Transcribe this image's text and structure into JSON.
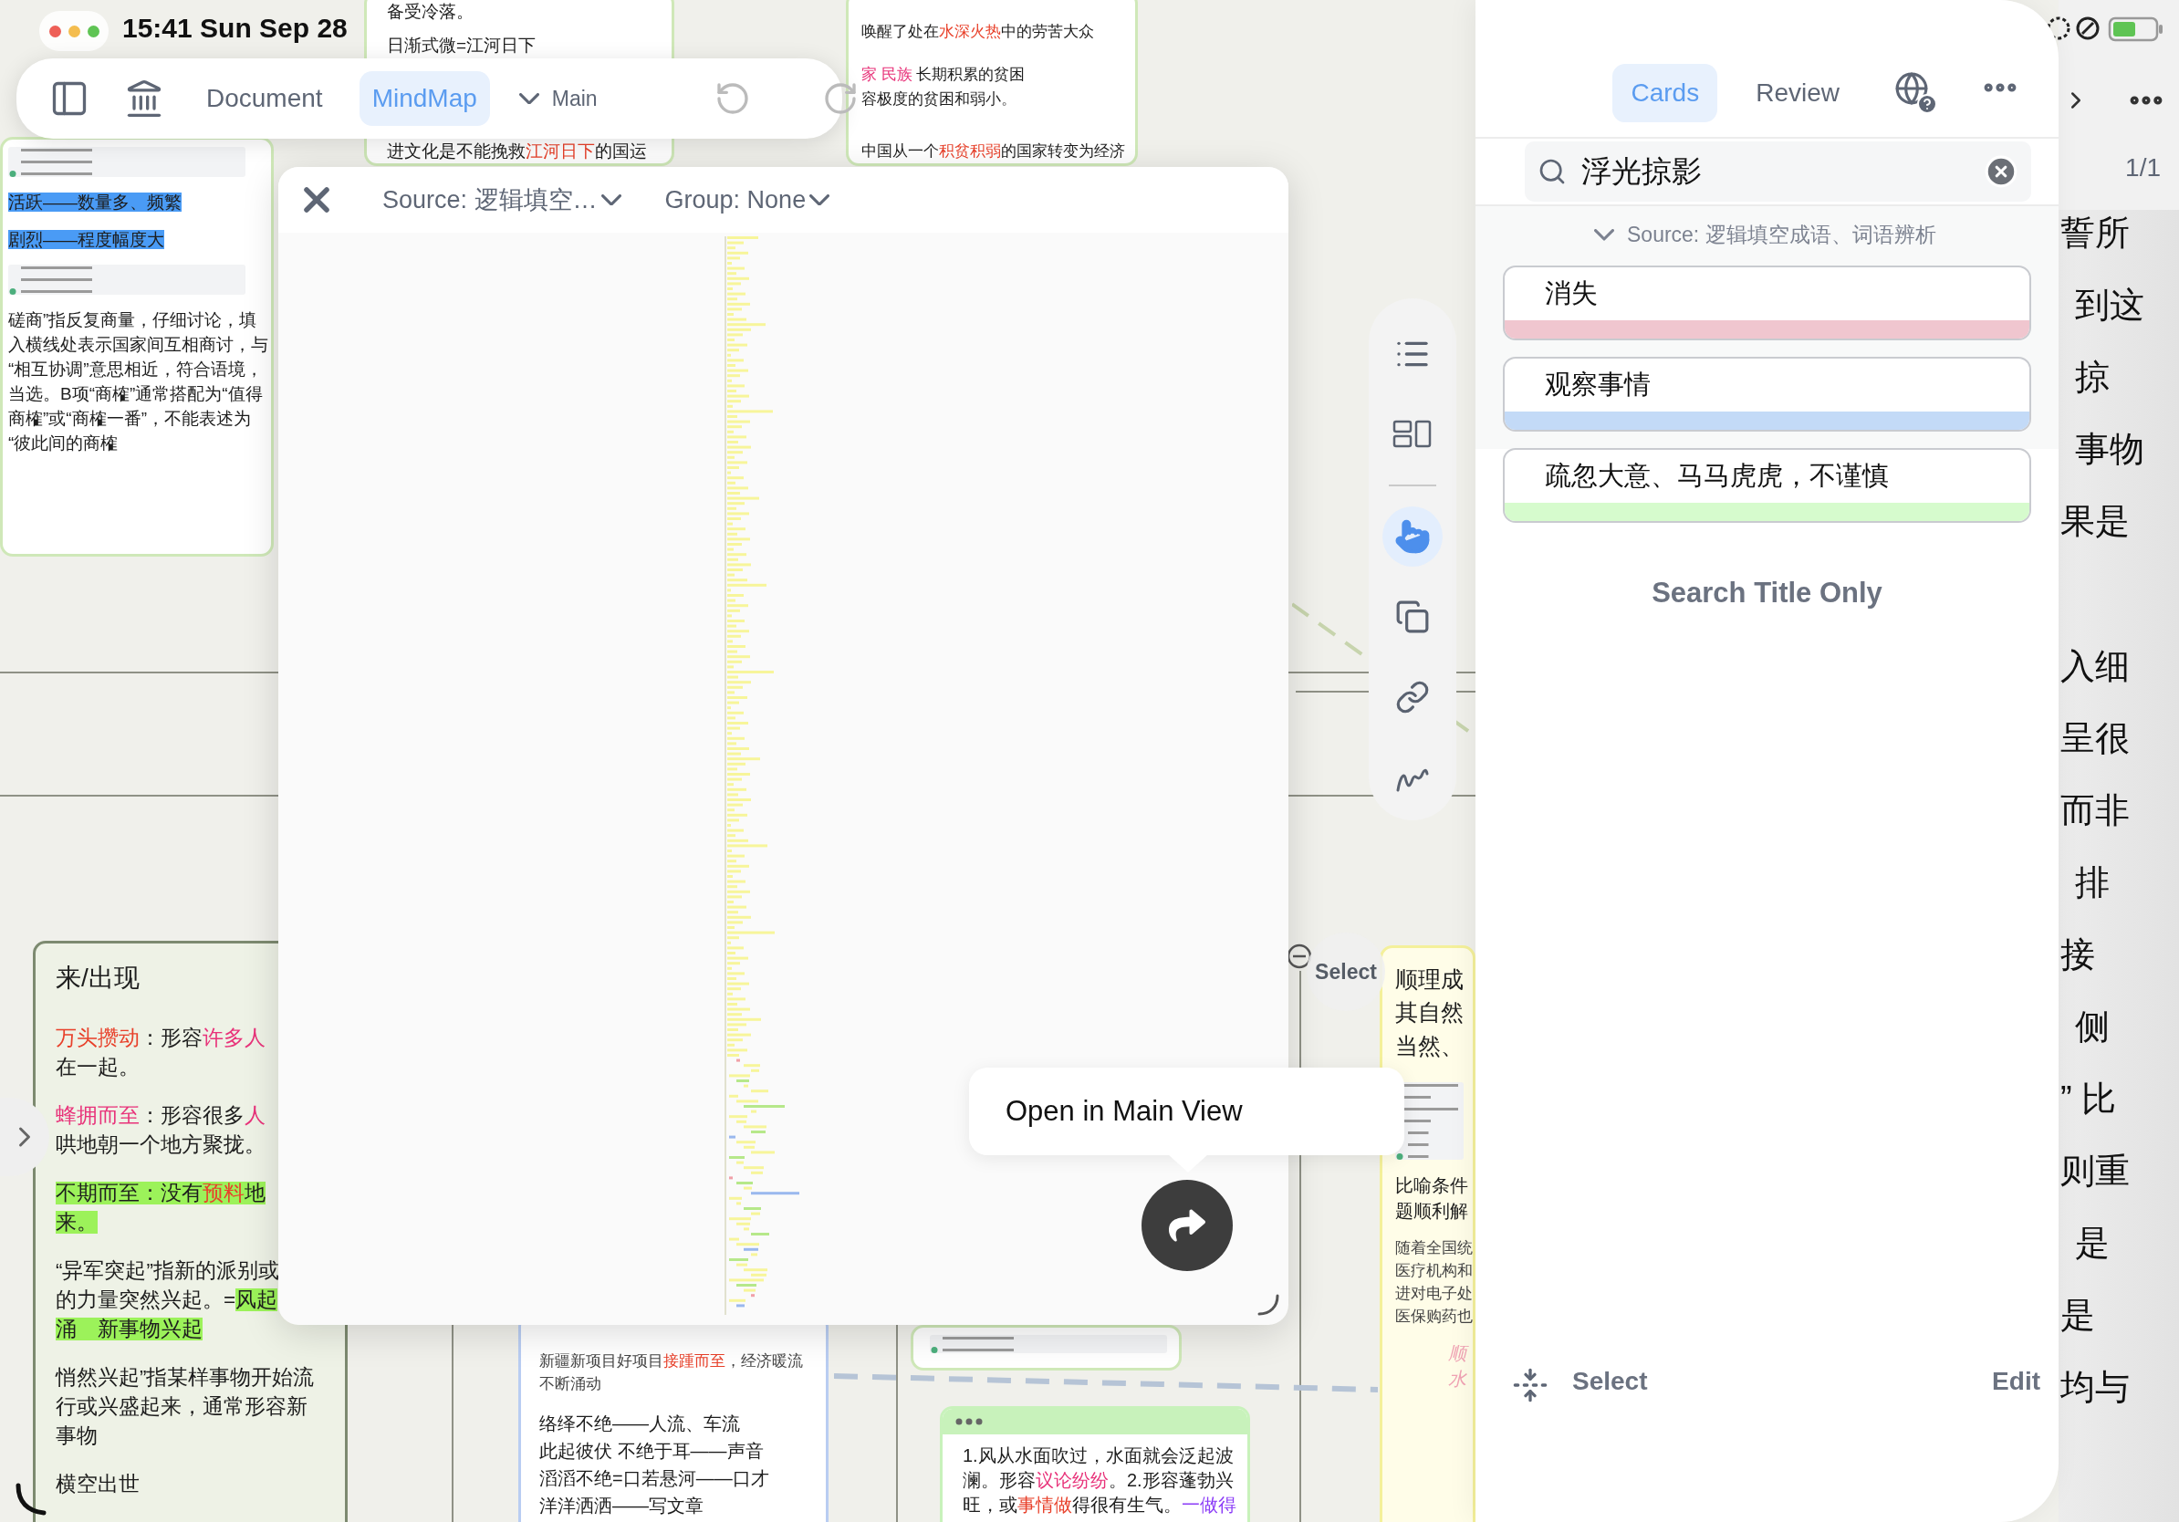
{
  "status_bar": {
    "time": "15:41 Sun Sep 28"
  },
  "toolbar": {
    "tabs": [
      {
        "label": "Document",
        "selected": false
      },
      {
        "label": "MindMap",
        "selected": true
      }
    ],
    "branch": "Main"
  },
  "canvas": {
    "cards": [
      {
        "kind": "note",
        "blocks": [
          {
            "kind": "thumbnail"
          },
          {
            "kind": "text",
            "lines": [
              [
                {
                  "kind": "selected",
                  "text": "活跃——数量多、频繁"
                }
              ]
            ]
          },
          {
            "kind": "text",
            "lines": [
              [
                {
                  "kind": "selected",
                  "text": "剧烈——程度幅度大"
                }
              ]
            ]
          },
          {
            "kind": "thumbnail"
          },
          {
            "kind": "text",
            "lines": [
              "磋商”指反复商量，仔细讨论，填",
              "入横线处表示国家间互相商讨，与",
              "“相互协调”意思相近，符合语境，",
              "当选。B项“商榷”通常搭配为“值得",
              "商榷”或“商榷一番”，不能表述为",
              "“彼此间的商榷"
            ]
          }
        ]
      },
      {
        "kind": "note",
        "blocks": [
          {
            "kind": "text",
            "lines": [
              "备受冷落。"
            ]
          },
          {
            "kind": "text",
            "lines": [
              "日渐式微=江河日下"
            ]
          },
          {
            "kind": "text",
            "lines": [
              [
                {
                  "kind": "plain",
                  "text": "进文化是不能挽救"
                },
                {
                  "kind": "keyword",
                  "text": "江河日下"
                },
                {
                  "kind": "plain",
                  "text": "的国运"
                }
              ]
            ]
          }
        ]
      },
      {
        "kind": "note",
        "blocks": [
          {
            "kind": "text",
            "lines": [
              [
                {
                  "kind": "plain",
                  "text": "唤醒了处在"
                },
                {
                  "kind": "keyword",
                  "text": "水深火热"
                },
                {
                  "kind": "plain",
                  "text": "中的劳苦大众"
                }
              ]
            ]
          },
          {
            "kind": "text",
            "lines": [
              [
                {
                  "kind": "term",
                  "text": "家 民族"
                },
                {
                  "kind": "plain",
                  "text": " 长期积累的贫困"
                }
              ],
              "容极度的贫困和弱小。"
            ]
          },
          {
            "kind": "text",
            "lines": [
              [
                {
                  "kind": "plain",
                  "text": "中国从一个"
                },
                {
                  "kind": "keyword",
                  "text": "积贫积弱"
                },
                {
                  "kind": "plain",
                  "text": "的国家转变为经济"
                }
              ]
            ]
          }
        ]
      },
      {
        "kind": "outlined",
        "blocks": [
          {
            "kind": "title",
            "lines": [
              "来/出现"
            ]
          },
          {
            "kind": "text",
            "lines": [
              [
                {
                  "kind": "keyword",
                  "text": "万头攒动"
                },
                {
                  "kind": "plain",
                  "text": "：形容"
                },
                {
                  "kind": "term",
                  "text": "许多人"
                }
              ],
              "在一起。"
            ]
          },
          {
            "kind": "text",
            "lines": [
              [
                {
                  "kind": "term",
                  "text": "蜂拥而至"
                },
                {
                  "kind": "plain",
                  "text": "：形容很多"
                },
                {
                  "kind": "term",
                  "text": "人"
                }
              ],
              "哄地朝一个地方聚拢。"
            ]
          },
          {
            "kind": "text",
            "lines": [
              [
                {
                  "kind": "marked",
                  "text": "不期而至：没有"
                },
                {
                  "kind": "marked_keyword",
                  "text": "预料"
                },
                {
                  "kind": "marked",
                  "text": "地"
                }
              ],
              [
                {
                  "kind": "marked",
                  "text": "来。"
                }
              ]
            ]
          },
          {
            "kind": "text",
            "lines": [
              "“异军突起”指新的派别或",
              [
                {
                  "kind": "plain",
                  "text": "的力量突然兴起。="
                },
                {
                  "kind": "marked",
                  "text": "风起"
                }
              ],
              [
                {
                  "kind": "marked",
                  "text": "涌　新事物兴起"
                }
              ]
            ]
          },
          {
            "kind": "text",
            "lines": [
              "悄然兴起”指某样事物开始流",
              "行或兴盛起来，通常形容新",
              "事物"
            ]
          },
          {
            "kind": "text",
            "lines": [
              "横空出世"
            ]
          }
        ]
      },
      {
        "kind": "framed",
        "blocks": [
          {
            "kind": "caption",
            "lines": [
              [
                {
                  "kind": "plain",
                  "text": "新疆新项目好项目"
                },
                {
                  "kind": "keyword",
                  "text": "接踵而至"
                },
                {
                  "kind": "plain",
                  "text": "，经济暖流"
                }
              ],
              "不断涌动"
            ]
          },
          {
            "kind": "text",
            "lines": [
              "络绎不绝——人流、车流",
              "此起彼伏 不绝于耳——声音",
              "滔滔不绝=口若悬河——口才",
              "洋洋洒洒——写文章"
            ]
          }
        ]
      },
      {
        "kind": "note",
        "blocks": [
          {
            "kind": "thumbnail"
          }
        ]
      },
      {
        "kind": "headed",
        "blocks": [
          {
            "kind": "dots"
          },
          {
            "kind": "text",
            "lines": [
              "1.风从水面吹过，水面就会泛起波",
              [
                {
                  "kind": "plain",
                  "text": "澜。形容"
                },
                {
                  "kind": "term",
                  "text": "议论纷纷"
                },
                {
                  "kind": "plain",
                  "text": "。2.形容蓬勃兴"
                }
              ],
              [
                {
                  "kind": "plain",
                  "text": "旺，或"
                },
                {
                  "kind": "keyword",
                  "text": "事情做"
                },
                {
                  "kind": "plain",
                  "text": "得很有生气。"
                },
                {
                  "kind": "accent",
                  "text": "一做得"
                }
              ]
            ]
          }
        ]
      },
      {
        "kind": "sticky",
        "blocks": [
          {
            "kind": "title",
            "lines": [
              "顺理成",
              "其自然",
              "当然、"
            ]
          },
          {
            "kind": "thumbnail"
          },
          {
            "kind": "text",
            "lines": [
              "比喻条件",
              "题顺利解"
            ]
          },
          {
            "kind": "caption",
            "lines": [
              "随着全国统",
              "医疗机构和",
              "进对电子处",
              "医保购药也"
            ]
          },
          {
            "kind": "handwriting",
            "lines": [
              "顺",
              "水"
            ]
          }
        ]
      }
    ]
  },
  "popup": {
    "source": "Source: 逻辑填空…",
    "group": "Group: None",
    "tooltip": "Open in Main View"
  },
  "tool_rail": {
    "view_tools": [
      {
        "kind": "outline",
        "selected": false
      },
      {
        "kind": "layout",
        "selected": false
      }
    ],
    "edit_tools": [
      {
        "kind": "pointer",
        "selected": true
      },
      {
        "kind": "copy",
        "selected": false
      },
      {
        "kind": "link",
        "selected": false
      },
      {
        "kind": "draw",
        "selected": false
      }
    ]
  },
  "canvas_select": "Select",
  "panel": {
    "tabs": [
      {
        "label": "Cards",
        "selected": true
      },
      {
        "label": "Review",
        "selected": false
      }
    ],
    "search": {
      "value": "浮光掠影"
    },
    "group": "Source: 逻辑填空成语、词语辨析",
    "cards": [
      {
        "title": "消失",
        "color": "#f0c6cf"
      },
      {
        "title": "观察事情",
        "color": "#c3daf7"
      },
      {
        "title": "疏忽大意、马马虎虎，不谨慎",
        "color": "#d6fbcd"
      }
    ],
    "search_title_only": "Search Title Only",
    "select": "Select",
    "edit": "Edit"
  },
  "side_text": {
    "counter": "1/1",
    "lines": [
      "誓所",
      "到这",
      "掠",
      "事物",
      "果是",
      "入细",
      "呈很",
      "而非",
      "排",
      "接",
      "侧",
      "” 比",
      "则重",
      "是",
      "是",
      "均与"
    ]
  }
}
